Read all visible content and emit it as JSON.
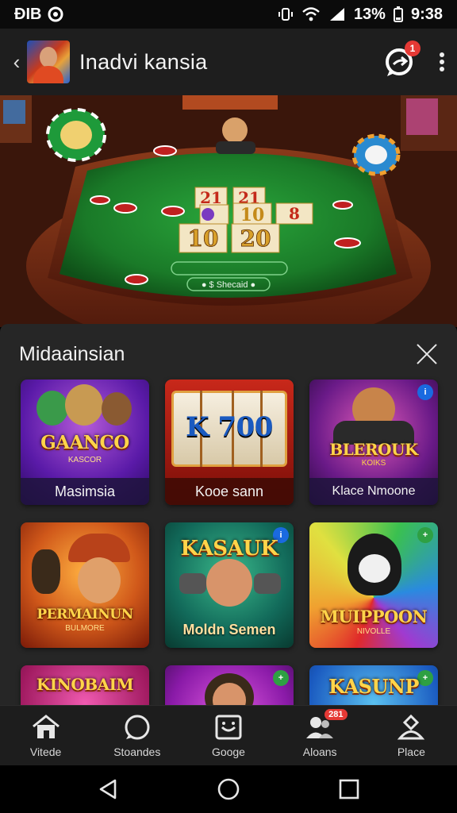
{
  "status_bar": {
    "left_text": "ÐIB",
    "battery": "13%",
    "time": "9:38"
  },
  "header": {
    "title": "Inadvi kansia",
    "chat_badge": "1"
  },
  "hero": {
    "table_cards": [
      "21",
      "10",
      "20",
      "10",
      "8"
    ],
    "table_labels": [
      "● $ Shecaid ●"
    ]
  },
  "panel": {
    "title": "Midaainsian",
    "tiles": [
      {
        "brand": "GAANCO",
        "sub": "KASCOR",
        "caption": "Masimsia",
        "badge": ""
      },
      {
        "brand": "K 700",
        "sub": "",
        "caption": "Kooe sann",
        "badge": ""
      },
      {
        "brand": "BLEROUK",
        "sub": "KOIKS",
        "caption": "Klace Nmoone",
        "badge": "i"
      },
      {
        "brand": "PERMAINUN",
        "sub": "BULMORE",
        "caption": "",
        "badge": ""
      },
      {
        "brand": "KASAUK",
        "sub": "",
        "caption": "Moldn Semen",
        "badge": "i"
      },
      {
        "brand": "MUIPPOON",
        "sub": "NIVOLLE",
        "caption": "",
        "badge": "+"
      },
      {
        "brand": "KINOBAIM",
        "sub": "",
        "caption": "",
        "badge": ""
      },
      {
        "brand": "",
        "sub": "",
        "caption": "",
        "badge": "+"
      },
      {
        "brand": "KASUNP",
        "sub": "",
        "caption": "",
        "badge": "+"
      }
    ]
  },
  "bottom_nav": {
    "items": [
      {
        "label": "Vitede",
        "icon": "home-icon"
      },
      {
        "label": "Stoandes",
        "icon": "circle-icon"
      },
      {
        "label": "Googe",
        "icon": "smile-box-icon"
      },
      {
        "label": "Aloans",
        "icon": "people-icon",
        "badge": "281"
      },
      {
        "label": "Place",
        "icon": "person-icon"
      }
    ]
  },
  "colors": {
    "accent": "#e53935",
    "panel_bg": "#262626",
    "header_bg": "#1e1e1e",
    "felt": "#1f8a2e"
  }
}
